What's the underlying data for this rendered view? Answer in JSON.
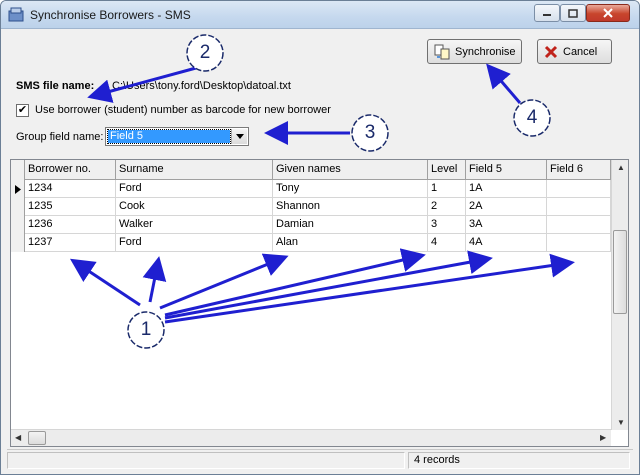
{
  "window": {
    "title": "Synchronise Borrowers - SMS"
  },
  "toolbar": {
    "synchronise_label": "Synchronise",
    "cancel_label": "Cancel"
  },
  "form": {
    "file_label": "SMS file name:",
    "file_value": "C:\\Users\\tony.ford\\Desktop\\datoal.txt",
    "barcode_checkbox_label": "Use borrower (student) number as barcode for new borrower",
    "barcode_checked": "✔",
    "group_label": "Group field name:",
    "group_value": "Field 5"
  },
  "grid": {
    "headers": [
      "Borrower no.",
      "Surname",
      "Given names",
      "Level",
      "Field 5",
      "Field 6"
    ],
    "rows": [
      [
        "1234",
        "Ford",
        "Tony",
        "1",
        "1A",
        ""
      ],
      [
        "1235",
        "Cook",
        "Shannon",
        "2",
        "2A",
        ""
      ],
      [
        "1236",
        "Walker",
        "Damian",
        "3",
        "3A",
        ""
      ],
      [
        "1237",
        "Ford",
        "Alan",
        "4",
        "4A",
        ""
      ]
    ]
  },
  "status": {
    "records": "4 records"
  },
  "callouts": {
    "c1": "1",
    "c2": "2",
    "c3": "3",
    "c4": "4"
  },
  "colors": {
    "selection": "#3399ff",
    "callout_stroke": "#1a2a6a",
    "arrow": "#1f1fd0"
  }
}
